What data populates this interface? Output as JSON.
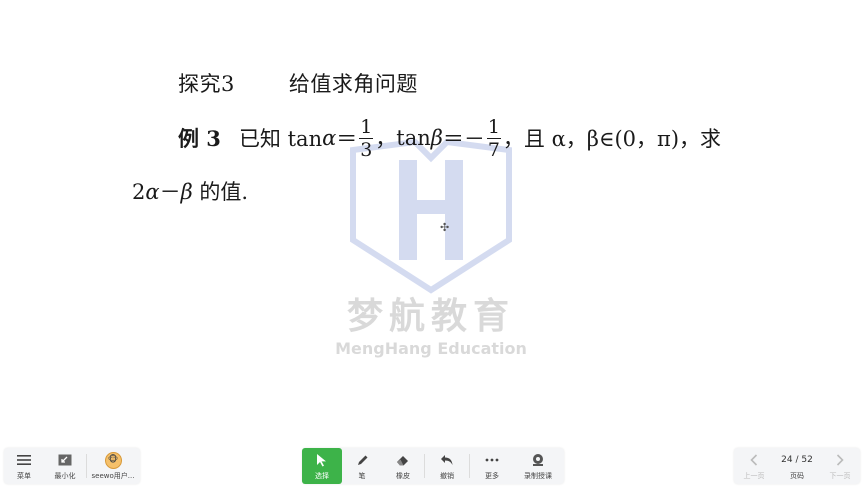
{
  "slide": {
    "heading": {
      "number": "探究3",
      "title": "给值求角问题"
    },
    "problem": {
      "label": "例 3",
      "known": "已知 tan",
      "alpha": "α",
      "eq": "＝",
      "frac1": {
        "num": "1",
        "den": "3"
      },
      "sep": "，",
      "tan": "tan",
      "beta": "β",
      "eq_neg": "＝－",
      "frac2": {
        "num": "1",
        "den": "7"
      },
      "condition": "，且 α，β∈(0，π)，求",
      "line2_a": "2",
      "line2_alpha": "α",
      "line2_minus": "－",
      "line2_beta": "β",
      "line2_end": " 的值."
    },
    "watermark": {
      "cn": "梦航教育",
      "en": "MengHang Education"
    }
  },
  "toolbar": {
    "left": {
      "menu": "菜单",
      "minimize": "最小化",
      "user": "seewo用户..."
    },
    "center": {
      "select": "选择",
      "pen": "笔",
      "eraser": "橡皮",
      "undo": "撤销",
      "more": "更多",
      "record": "录制授课"
    },
    "right": {
      "prev": "上一页",
      "page": "24 / 52",
      "page_label": "页码",
      "next": "下一页"
    }
  },
  "colors": {
    "accent": "#3db349",
    "watermark_blue": "#3f5fbf"
  }
}
